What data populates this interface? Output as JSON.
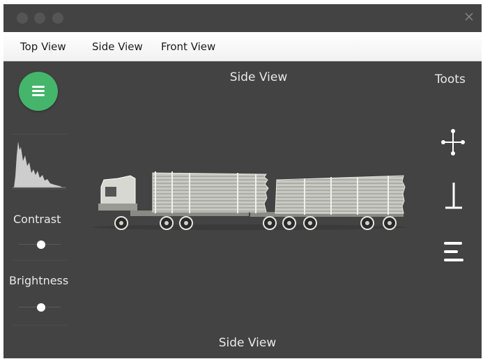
{
  "menu": {
    "items": [
      "Top View",
      "Side View",
      "Front View"
    ]
  },
  "main": {
    "top_title": "Side View",
    "bottom_title": "Side View"
  },
  "toolbar": {
    "title": "Toots",
    "tools": [
      "move-icon",
      "perpendicular-icon",
      "align-icon"
    ]
  },
  "adjust": {
    "contrast_label": "Contrast",
    "contrast_value": 0.55,
    "brightness_label": "Brightness",
    "brightness_value": 0.55
  },
  "colors": {
    "window_bg": "#434343",
    "accent": "#45b56b",
    "menubar_bg": "#f4f4f4"
  }
}
